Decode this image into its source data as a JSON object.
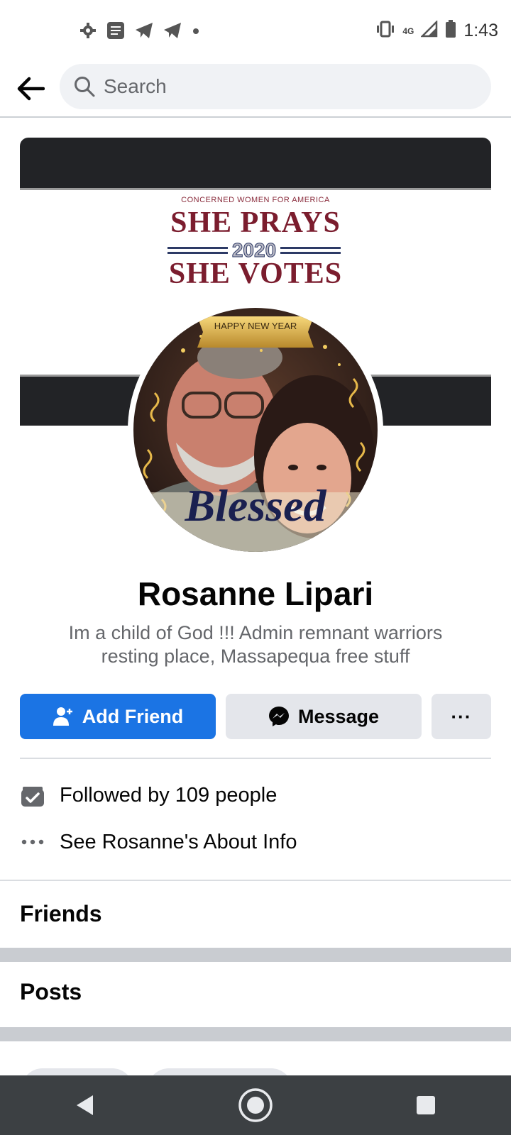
{
  "status_bar": {
    "time": "1:43",
    "network": "4G",
    "icons_left": [
      "settings-icon",
      "message-notification-icon",
      "telegram-icon",
      "telegram-icon",
      "dot-icon"
    ],
    "icons_right": [
      "vibrate-icon",
      "signal-icon",
      "battery-icon"
    ]
  },
  "header": {
    "search_placeholder": "Search"
  },
  "cover": {
    "org_line": "CONCERNED WOMEN FOR AMERICA",
    "line1": "SHE PRAYS",
    "year": "2020",
    "line2": "SHE VOTES"
  },
  "avatar": {
    "banner": "HAPPY NEW YEAR",
    "caption": "Blessed"
  },
  "profile": {
    "name": "Rosanne Lipari",
    "bio": "Im a child of God !!!  Admin remnant warriors\nresting place,   Massapequa free stuff"
  },
  "actions": {
    "add_friend": "Add Friend",
    "message": "Message",
    "more": "···"
  },
  "info": {
    "followed_by": "Followed by 109 people",
    "about": "See Rosanne's About Info"
  },
  "sections": {
    "friends": "Friends",
    "posts": "Posts"
  },
  "colors": {
    "primary": "#1b74e4",
    "secondary_bg": "#e4e6eb",
    "muted_text": "#65676b",
    "nav_bg": "#3c4043"
  }
}
